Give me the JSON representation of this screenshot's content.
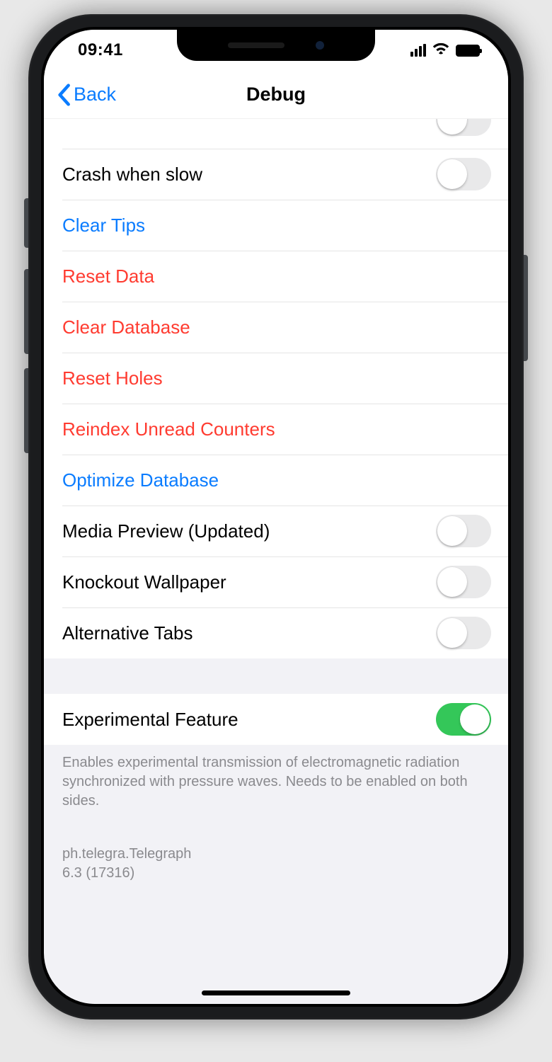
{
  "statusbar": {
    "time": "09:41"
  },
  "nav": {
    "back": "Back",
    "title": "Debug"
  },
  "rows": {
    "crash_when_slow": "Crash when slow",
    "clear_tips": "Clear Tips",
    "reset_data": "Reset Data",
    "clear_database": "Clear Database",
    "reset_holes": "Reset Holes",
    "reindex_unread": "Reindex Unread Counters",
    "optimize_db": "Optimize Database",
    "media_preview": "Media Preview (Updated)",
    "knockout_wallpaper": "Knockout Wallpaper",
    "alternative_tabs": "Alternative Tabs",
    "experimental_feature": "Experimental Feature"
  },
  "switches": {
    "hidden_top": false,
    "crash_when_slow": false,
    "media_preview": false,
    "knockout_wallpaper": false,
    "alternative_tabs": false,
    "experimental_feature": true
  },
  "footer": {
    "experimental_note": "Enables experimental transmission of electromagnetic radiation synchronized with pressure waves. Needs to be enabled on both sides.",
    "bundle_id": "ph.telegra.Telegraph",
    "version": "6.3 (17316)"
  }
}
